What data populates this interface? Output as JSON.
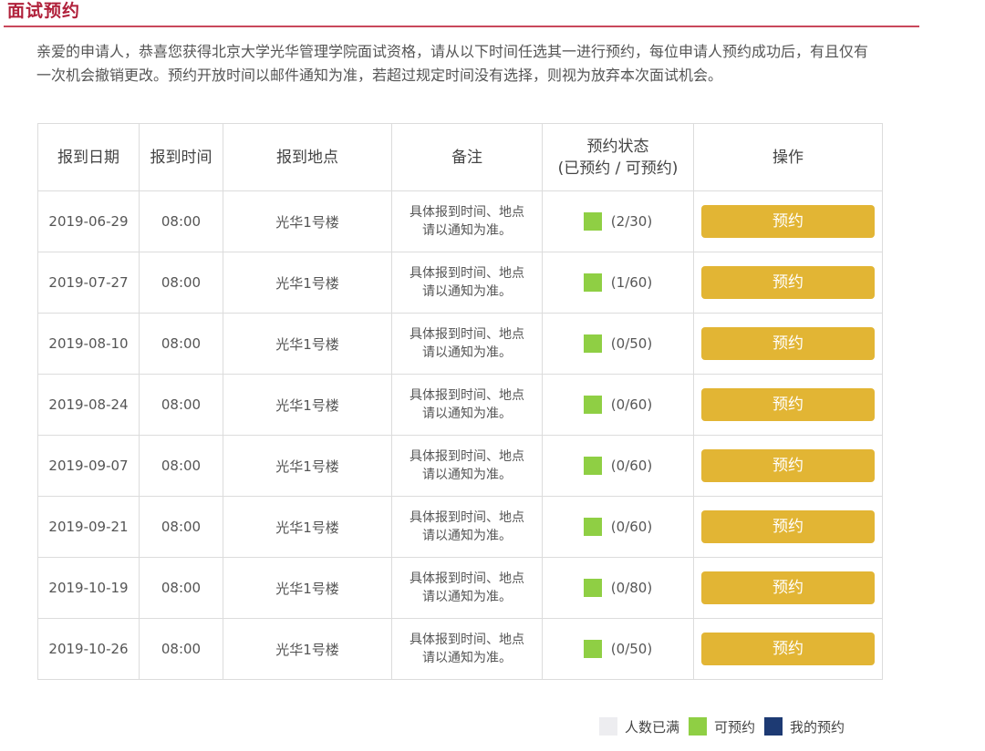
{
  "page": {
    "title": "面试预约",
    "intro": "亲爱的申请人，恭喜您获得北京大学光华管理学院面试资格，请从以下时间任选其一进行预约，每位申请人预约成功后，有且仅有一次机会撤销更改。预约开放时间以邮件通知为准，若超过规定时间没有选择，则视为放弃本次面试机会。"
  },
  "table": {
    "headers": {
      "date": "报到日期",
      "time": "报到时间",
      "location": "报到地点",
      "note": "备注",
      "status_line1": "预约状态",
      "status_line2": "(已预约 / 可预约)",
      "action": "操作"
    },
    "rows": [
      {
        "date": "2019-06-29",
        "time": "08:00",
        "location": "光华1号楼",
        "note_line1": "具体报到时间、地点",
        "note_line2": "请以通知为准。",
        "status": "(2/30)",
        "button": "预约"
      },
      {
        "date": "2019-07-27",
        "time": "08:00",
        "location": "光华1号楼",
        "note_line1": "具体报到时间、地点",
        "note_line2": "请以通知为准。",
        "status": "(1/60)",
        "button": "预约"
      },
      {
        "date": "2019-08-10",
        "time": "08:00",
        "location": "光华1号楼",
        "note_line1": "具体报到时间、地点",
        "note_line2": "请以通知为准。",
        "status": "(0/50)",
        "button": "预约"
      },
      {
        "date": "2019-08-24",
        "time": "08:00",
        "location": "光华1号楼",
        "note_line1": "具体报到时间、地点",
        "note_line2": "请以通知为准。",
        "status": "(0/60)",
        "button": "预约"
      },
      {
        "date": "2019-09-07",
        "time": "08:00",
        "location": "光华1号楼",
        "note_line1": "具体报到时间、地点",
        "note_line2": "请以通知为准。",
        "status": "(0/60)",
        "button": "预约"
      },
      {
        "date": "2019-09-21",
        "time": "08:00",
        "location": "光华1号楼",
        "note_line1": "具体报到时间、地点",
        "note_line2": "请以通知为准。",
        "status": "(0/60)",
        "button": "预约"
      },
      {
        "date": "2019-10-19",
        "time": "08:00",
        "location": "光华1号楼",
        "note_line1": "具体报到时间、地点",
        "note_line2": "请以通知为准。",
        "status": "(0/80)",
        "button": "预约"
      },
      {
        "date": "2019-10-26",
        "time": "08:00",
        "location": "光华1号楼",
        "note_line1": "具体报到时间、地点",
        "note_line2": "请以通知为准。",
        "status": "(0/50)",
        "button": "预约"
      }
    ]
  },
  "legend": {
    "full": {
      "label": "人数已满",
      "color": "#ededf0"
    },
    "available": {
      "label": "可预约",
      "color": "#8fcf44"
    },
    "mine": {
      "label": "我的预约",
      "color": "#1d3a73"
    }
  },
  "colors": {
    "accent_title": "#b0213b",
    "button": "#e2b534",
    "available_status": "#8fcf44"
  }
}
